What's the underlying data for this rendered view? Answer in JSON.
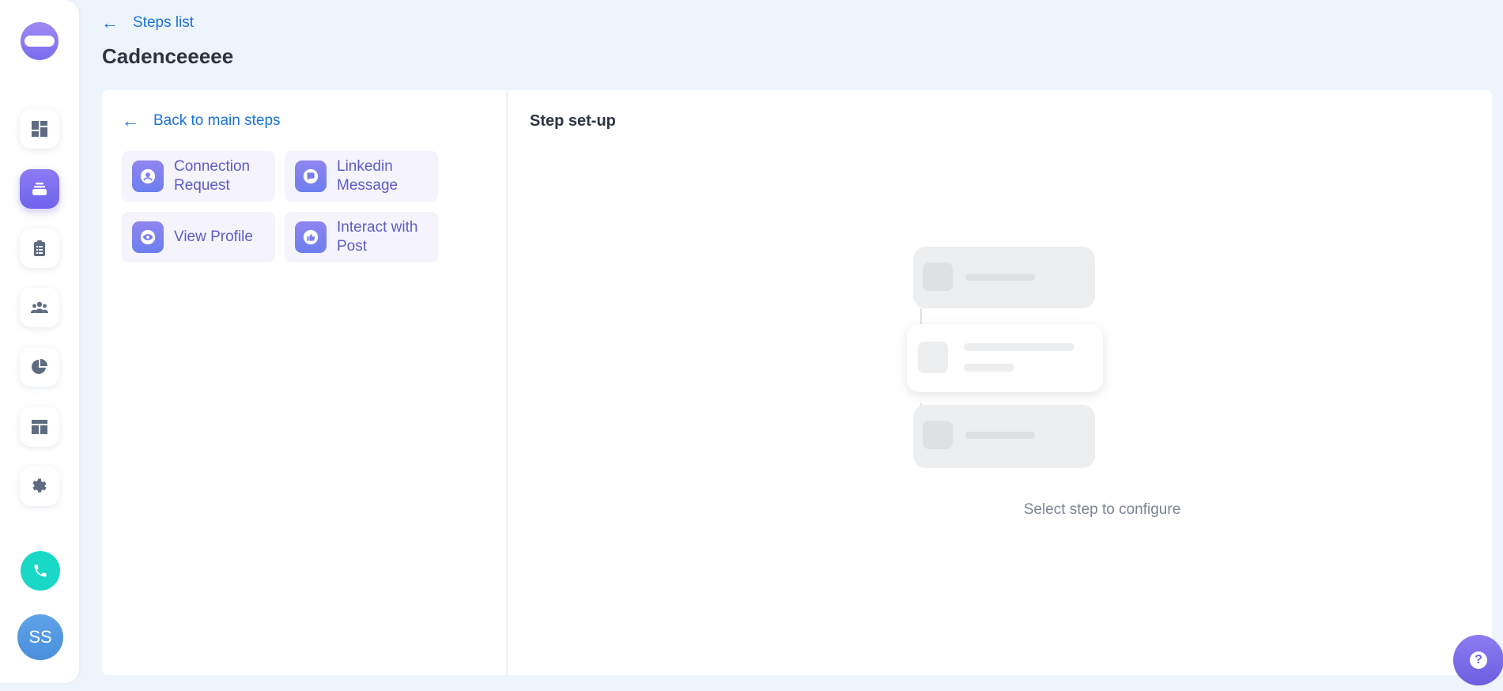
{
  "header": {
    "back_label": "Steps list",
    "title": "Cadenceeeee"
  },
  "sidebar": {
    "items": [
      {
        "icon": "dashboard-icon"
      },
      {
        "icon": "inbox-stack-icon",
        "active": true
      },
      {
        "icon": "clipboard-icon"
      },
      {
        "icon": "team-icon"
      },
      {
        "icon": "pie-chart-icon"
      },
      {
        "icon": "layout-icon"
      },
      {
        "icon": "gear-icon"
      }
    ],
    "call_icon": "phone-icon",
    "avatar_initials": "SS"
  },
  "left_panel": {
    "back_label": "Back to main steps",
    "steps": [
      {
        "label": "Connection Request",
        "line1": "Connection",
        "line2": "Request",
        "icon": "user-circle-icon"
      },
      {
        "label": "Linkedin Message",
        "line1": "Linkedin",
        "line2": "Message",
        "icon": "chat-bubble-icon"
      },
      {
        "label": "View Profile",
        "line1": "View Profile",
        "line2": "",
        "icon": "eye-icon"
      },
      {
        "label": "Interact with Post",
        "line1": "Interact with",
        "line2": "Post",
        "icon": "thumbs-up-icon"
      }
    ]
  },
  "right_panel": {
    "title": "Step set-up",
    "empty_text": "Select step to configure"
  },
  "colors": {
    "accent": "#6f63ee",
    "link": "#1a73d9",
    "call": "#19d9c6",
    "background": "#eef4fb"
  }
}
